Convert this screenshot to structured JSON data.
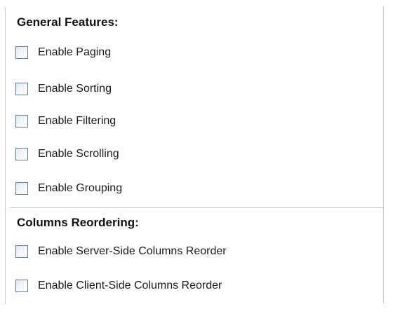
{
  "general_features": {
    "title": "General Features:",
    "options": [
      {
        "label": "Enable Paging",
        "checked": false
      },
      {
        "label": "Enable Sorting",
        "checked": false
      },
      {
        "label": "Enable Filtering",
        "checked": false
      },
      {
        "label": "Enable Scrolling",
        "checked": false
      },
      {
        "label": "Enable Grouping",
        "checked": false
      }
    ]
  },
  "columns_reordering": {
    "title": "Columns Reordering:",
    "options": [
      {
        "label": "Enable Server-Side Columns Reorder",
        "checked": false
      },
      {
        "label": "Enable Client-Side Columns Reorder",
        "checked": false
      }
    ]
  },
  "colors": {
    "checkbox_border": "#5a7fa8",
    "divider": "#c8c8c8",
    "text": "#1a1a1a"
  }
}
